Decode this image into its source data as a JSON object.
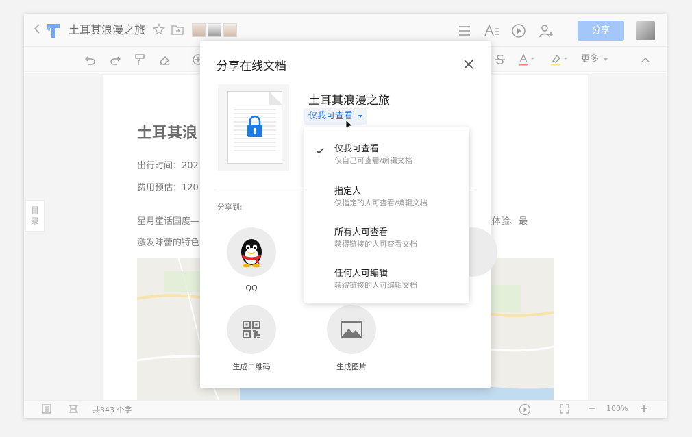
{
  "app": {
    "title": "土耳其浪漫之旅"
  },
  "header": {
    "share_label": "分享"
  },
  "toolbar": {
    "more_label": "更多"
  },
  "sidebar": {
    "toc_label": "目录"
  },
  "document": {
    "heading": "土耳其浪",
    "travel_time": "出行时间：202",
    "cost_estimate": "费用预估：120",
    "para_left_1": "星月童话国度—",
    "para_right_1": "瞰体验、最",
    "para_left_2": "激发味蕾的特色"
  },
  "status": {
    "word_count": "共343 个字",
    "zoom": "100%"
  },
  "dialog": {
    "title": "分享在线文档",
    "file_name": "土耳其浪漫之旅",
    "permission_current": "仅我可查看",
    "share_to_label": "分享到:",
    "share_options": [
      {
        "label": "QQ",
        "icon": "qq-penguin-icon"
      },
      {
        "label": "生成二维码",
        "icon": "qrcode-icon"
      },
      {
        "label": "生成图片",
        "icon": "image-icon"
      }
    ]
  },
  "permission_menu": {
    "items": [
      {
        "title": "仅我可查看",
        "desc": "仅自己可查看/编辑文档",
        "selected": true
      },
      {
        "title": "指定人",
        "desc": "仅指定的人可查看/编辑文档",
        "selected": false
      },
      {
        "title": "所有人可查看",
        "desc": "获得链接的人可查看文档",
        "selected": false
      },
      {
        "title": "任何人可编辑",
        "desc": "获得链接的人可编辑文档",
        "selected": false
      }
    ]
  },
  "colors": {
    "accent": "#2f6fd6",
    "share_button": "#7fb2f5",
    "lock_blue": "#1e7be6"
  }
}
